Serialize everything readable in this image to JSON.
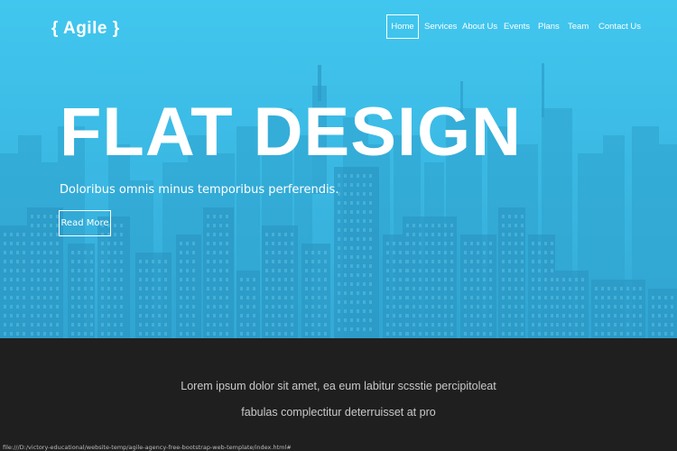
{
  "header": {
    "logo": "{ Agile }",
    "nav": [
      {
        "label": "Home",
        "active": true
      },
      {
        "label": "Services",
        "active": false
      },
      {
        "label": "About Us",
        "active": false
      },
      {
        "label": "Events",
        "active": false
      },
      {
        "label": "Plans",
        "active": false
      },
      {
        "label": "Team",
        "active": false
      },
      {
        "label": "Contact Us",
        "active": false
      }
    ]
  },
  "hero": {
    "title": "FLAT DESIGN",
    "subtitle": "Doloribus omnis minus temporibus perferendis.",
    "button_label": "Read More",
    "overlay_color": "#3bbbe6"
  },
  "intro": {
    "line1": "Lorem ipsum dolor sit amet, ea eum labitur scsstie percipitoleat",
    "line2": "fabulas complectitur deterruisset at pro"
  },
  "status_bar": {
    "url": "file:///D:/victory-educational/website-temp/agile-agency-free-bootstrap-web-template/index.html#"
  },
  "colors": {
    "hero_overlay": "#3bbbe6",
    "band_background": "#1f1f1f",
    "band_text": "#c9c9c9"
  }
}
